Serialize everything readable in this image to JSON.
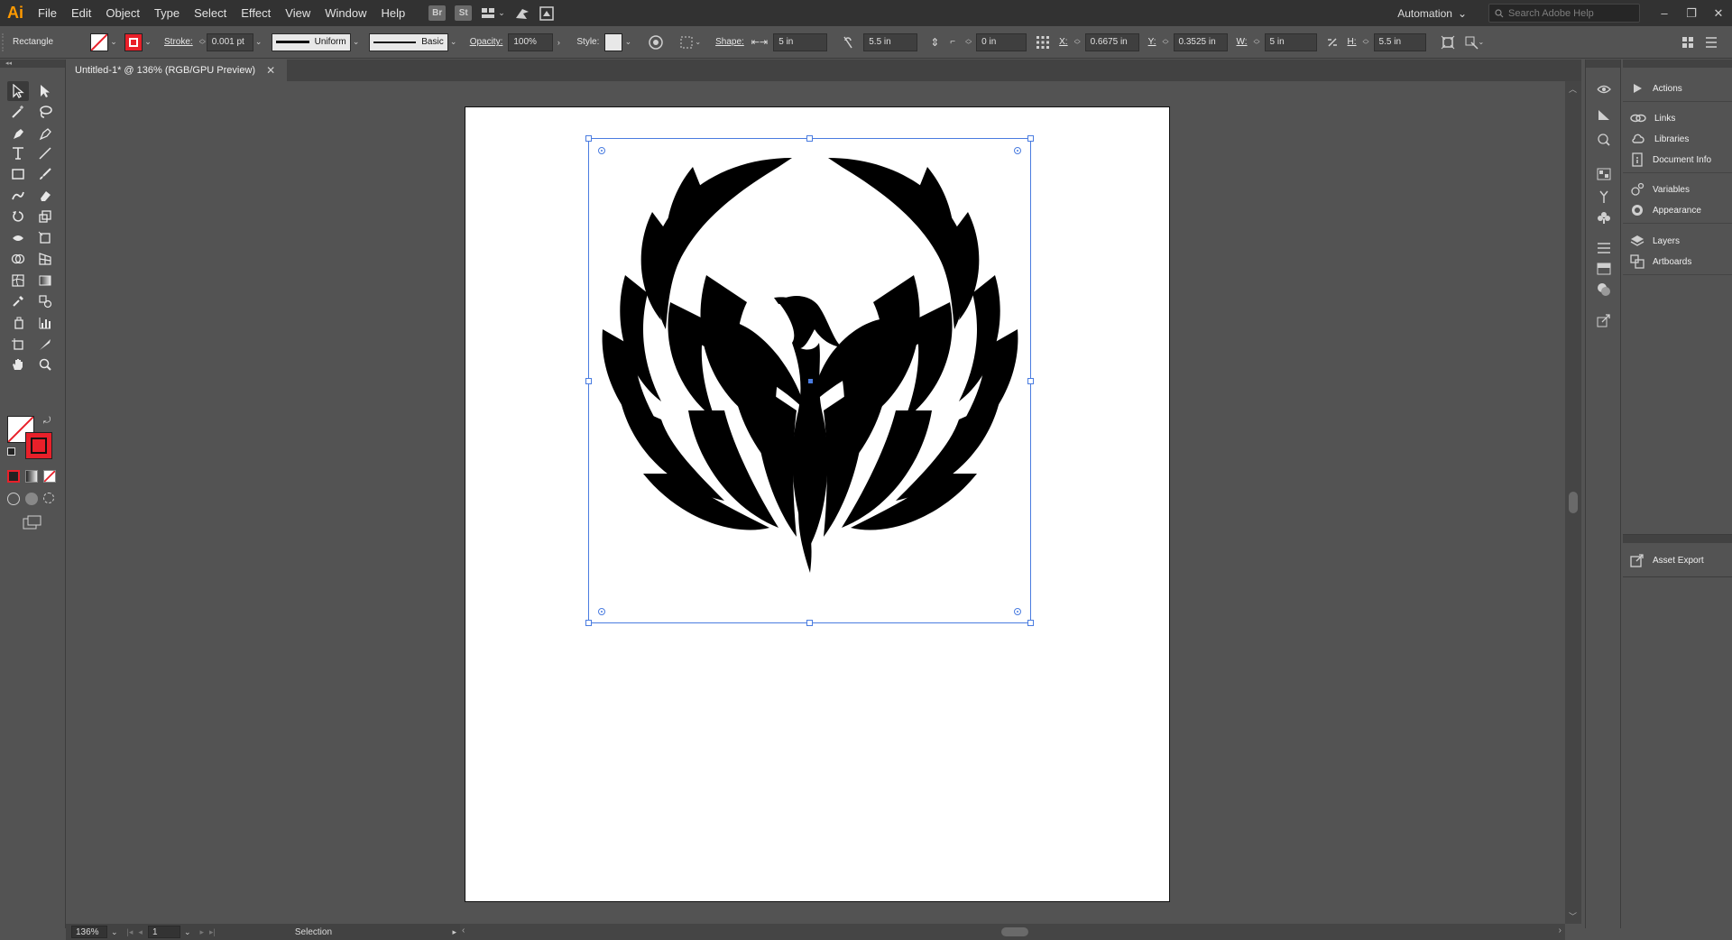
{
  "app": {
    "logo_text": "Ai"
  },
  "menu": {
    "items": [
      "File",
      "Edit",
      "Object",
      "Type",
      "Select",
      "Effect",
      "View",
      "Window",
      "Help"
    ],
    "bridge_label": "Br",
    "stock_label": "St",
    "workspace": "Automation",
    "search_placeholder": "Search Adobe Help"
  },
  "control_bar": {
    "selection_type": "Rectangle",
    "stroke_label": "Stroke:",
    "stroke_weight": "0.001 pt",
    "variable_width": "Uniform",
    "brush": "Basic",
    "opacity_label": "Opacity:",
    "opacity_value": "100%",
    "style_label": "Style:",
    "shape_label": "Shape:",
    "shape_width": "5 in",
    "shape_height": "5.5 in",
    "corner_radius": "0 in",
    "x_label": "X:",
    "x_value": "0.6675 in",
    "y_label": "Y:",
    "y_value": "0.3525 in",
    "w_label": "W:",
    "w_value": "5 in",
    "h_label": "H:",
    "h_value": "5.5 in",
    "colors": {
      "fill": "none",
      "stroke": "#e8202a"
    }
  },
  "document": {
    "tab_title": "Untitled-1* @ 136% (RGB/GPU Preview)"
  },
  "status_bar": {
    "zoom": "136%",
    "artboard_number": "1",
    "tool_name": "Selection"
  },
  "right_panels": {
    "items": [
      {
        "label": "Actions",
        "icon": "play-icon"
      },
      {
        "label": "Links",
        "icon": "link-icon"
      },
      {
        "label": "Libraries",
        "icon": "libraries-icon"
      },
      {
        "label": "Document Info",
        "icon": "info-icon"
      },
      {
        "label": "Variables",
        "icon": "variables-icon"
      },
      {
        "label": "Appearance",
        "icon": "appearance-icon"
      },
      {
        "label": "Layers",
        "icon": "layers-icon"
      },
      {
        "label": "Artboards",
        "icon": "artboards-icon"
      }
    ],
    "asset_export": "Asset Export"
  }
}
